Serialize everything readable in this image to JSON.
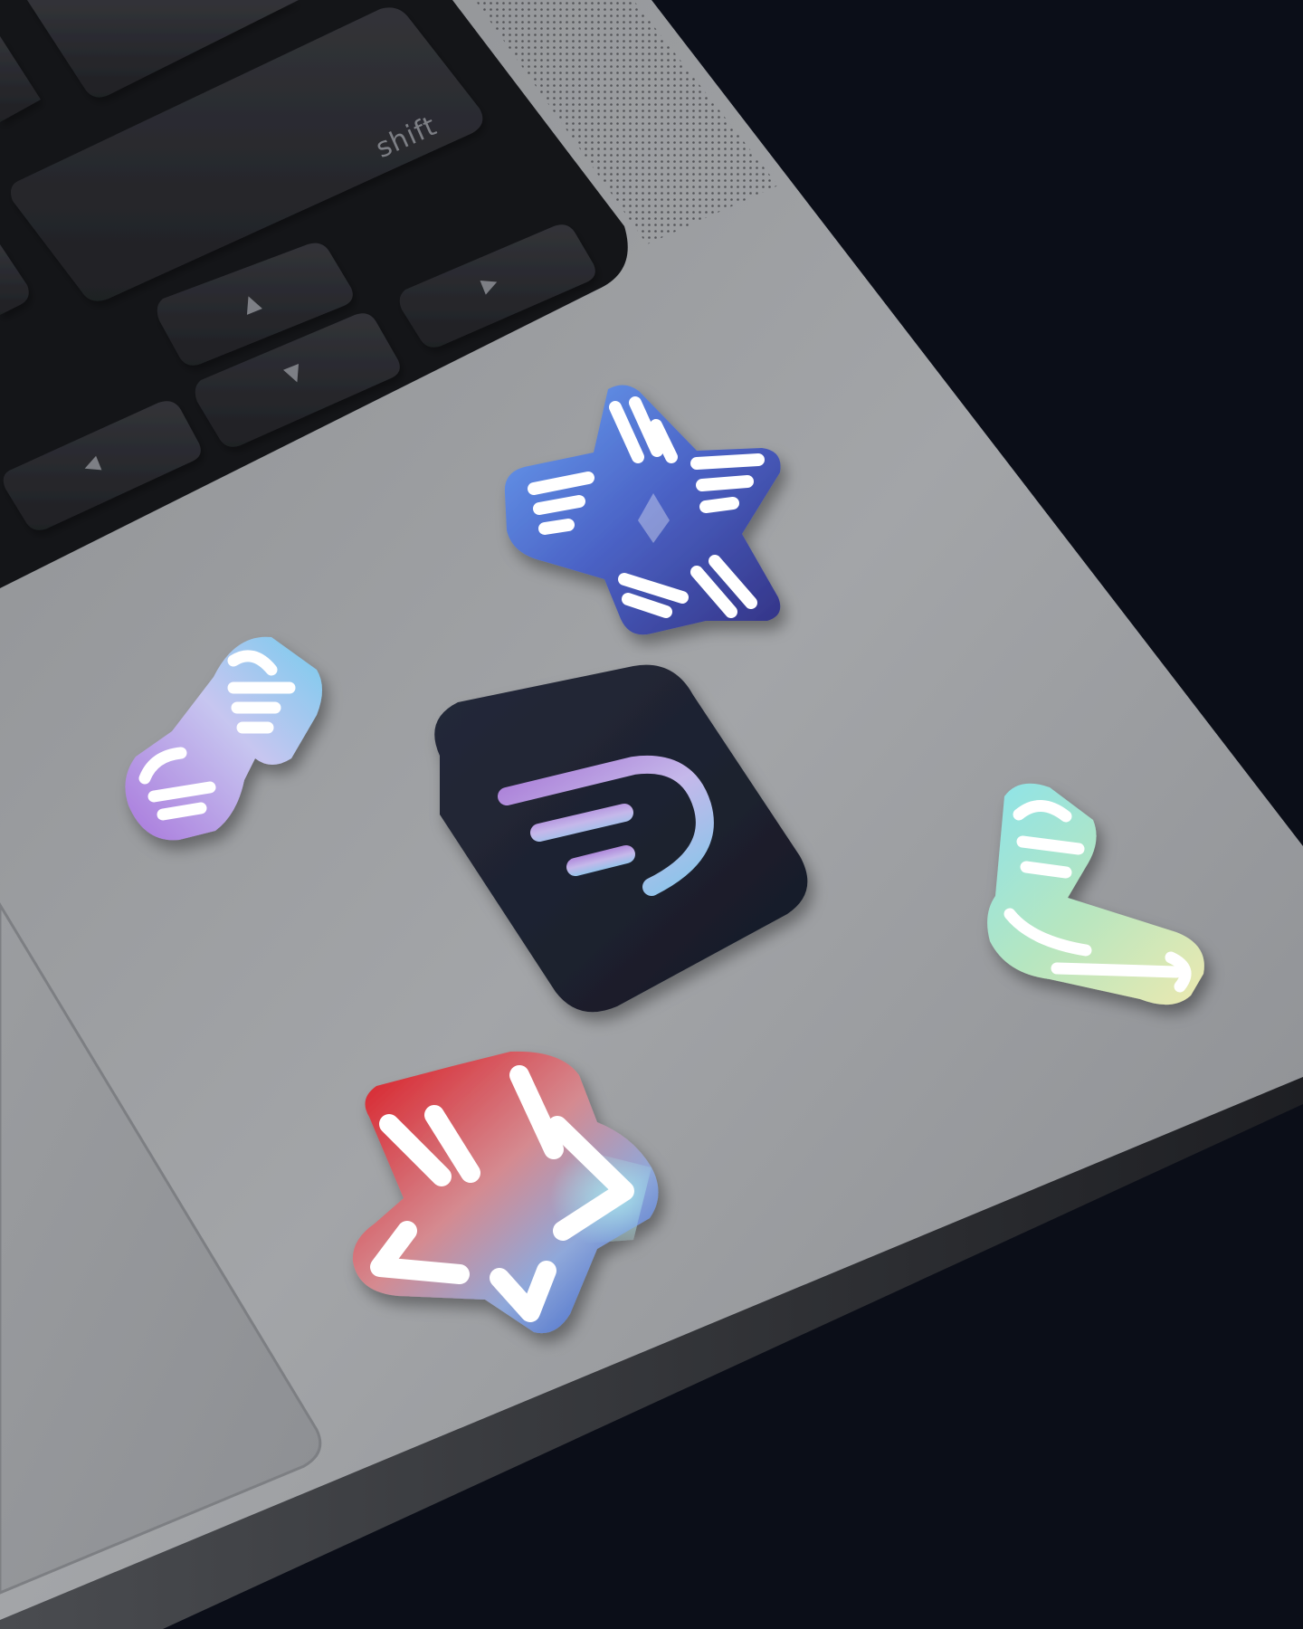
{
  "scene": {
    "description_free_text": "",
    "background_color": "#0b0e18",
    "laptop_color": "#9fa1a4",
    "keyboard_well_color": "#141518",
    "key_color": "#2a2b2f"
  },
  "keyboard": {
    "shift_label": "shift",
    "arrow_up_glyph": "▲",
    "arrow_down_glyph": "▼",
    "arrow_left_glyph": "◀",
    "arrow_right_glyph": "▶",
    "label_color": "#7d7f85"
  },
  "stickers": [
    {
      "id": "winged-star-sticker",
      "colors": [
        "#5b8ee8",
        "#3a3f9a"
      ]
    },
    {
      "id": "wings-pair-sticker",
      "colors": [
        "#b07ee0",
        "#7ec9ec"
      ]
    },
    {
      "id": "app-icon-sticker",
      "colors": [
        "#1b2030",
        "#b88ee0",
        "#8ec8e8"
      ]
    },
    {
      "id": "single-wing-sticker",
      "colors": [
        "#8fe0e6",
        "#e8ecb0"
      ]
    },
    {
      "id": "arrow-star-sticker",
      "colors": [
        "#d61f2a",
        "#2f62c8",
        "#9ee0e6"
      ]
    }
  ]
}
